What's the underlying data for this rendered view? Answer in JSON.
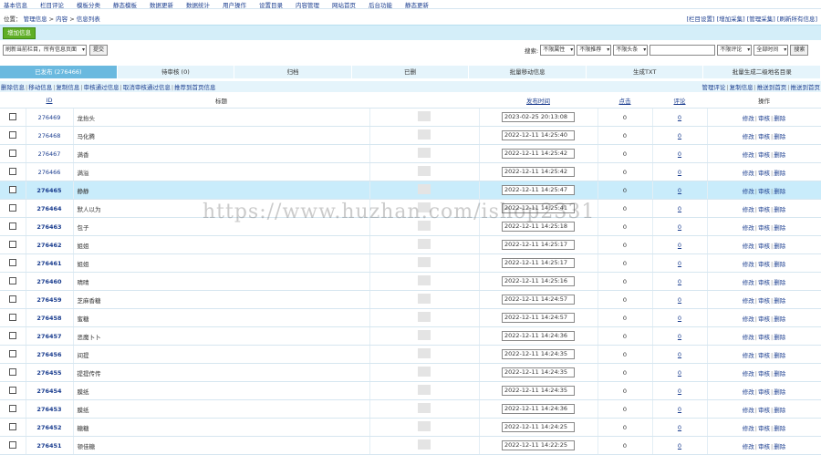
{
  "topnav": [
    "基本信息",
    "栏目评论",
    "模板分类",
    "静态模板",
    "数据更新",
    "数据统计",
    "用户操作",
    "设置目录",
    "内容管理",
    "网站首页",
    "后台功能",
    "静态更新"
  ],
  "breadcrumb": {
    "prefix": "位置：",
    "parts": [
      "管理信息",
      "内容",
      "信息列表"
    ]
  },
  "top_right": "[栏目设置] [增加采集] [管理采集] [刷新所有信息]",
  "add_button": "增加信息",
  "filter": {
    "select1": "刷新当前栏目，所有信息页面",
    "btn1": "提交",
    "label": "搜索:",
    "select2": "不限属性",
    "select3": "不限推荐",
    "select4": "不限头条",
    "select5": "不限评论",
    "select6": "全部时间",
    "btn2": "搜索"
  },
  "tabs": [
    "已发布 (276466)",
    "待审核 (0)",
    "归档",
    "已删",
    "批量移动信息",
    "生成TXT",
    "批量生成二级地名目录"
  ],
  "subactions_left": [
    "删除信息",
    "移动信息",
    "复制信息",
    "审核通过信息",
    "取消审核通过信息",
    "推荐到首页信息"
  ],
  "subactions_right": [
    "管理评论",
    "复制信息",
    "推送到首页",
    "推送到首页"
  ],
  "columns": {
    "id": "ID",
    "title": "标题",
    "blurred": "",
    "date": "发布时间",
    "clicks": "点击",
    "comments": "评论",
    "ops": "操作"
  },
  "ops": {
    "edit": "修改",
    "check": "审核",
    "del": "删除"
  },
  "rows": [
    {
      "id": "276469",
      "title": "龙抬头",
      "date": "2023-02-25 20:13:08",
      "clicks": "0",
      "comments": "0",
      "bold": false,
      "hl": false
    },
    {
      "id": "276468",
      "title": "马化腾",
      "date": "2022-12-11 14:25:40",
      "clicks": "0",
      "comments": "0",
      "bold": false,
      "hl": false
    },
    {
      "id": "276467",
      "title": "满香",
      "date": "2022-12-11 14:25:42",
      "clicks": "0",
      "comments": "0",
      "bold": false,
      "hl": false
    },
    {
      "id": "276466",
      "title": "满溢",
      "date": "2022-12-11 14:25:42",
      "clicks": "0",
      "comments": "0",
      "bold": false,
      "hl": false
    },
    {
      "id": "276465",
      "title": "静静",
      "date": "2022-12-11 14:25:47",
      "clicks": "0",
      "comments": "0",
      "bold": true,
      "hl": true
    },
    {
      "id": "276464",
      "title": "默人以为",
      "date": "2022-12-11 14:25:41",
      "clicks": "0",
      "comments": "0",
      "bold": true,
      "hl": false
    },
    {
      "id": "276463",
      "title": "包子",
      "date": "2022-12-11 14:25:18",
      "clicks": "0",
      "comments": "0",
      "bold": true,
      "hl": false
    },
    {
      "id": "276462",
      "title": "姐姐",
      "date": "2022-12-11 14:25:17",
      "clicks": "0",
      "comments": "0",
      "bold": true,
      "hl": false
    },
    {
      "id": "276461",
      "title": "姐姐",
      "date": "2022-12-11 14:25:17",
      "clicks": "0",
      "comments": "0",
      "bold": true,
      "hl": false
    },
    {
      "id": "276460",
      "title": "晴晴",
      "date": "2022-12-11 14:25:16",
      "clicks": "0",
      "comments": "0",
      "bold": true,
      "hl": false
    },
    {
      "id": "276459",
      "title": "芝麻香糖",
      "date": "2022-12-11 14:24:57",
      "clicks": "0",
      "comments": "0",
      "bold": true,
      "hl": false
    },
    {
      "id": "276458",
      "title": "蜜糖",
      "date": "2022-12-11 14:24:57",
      "clicks": "0",
      "comments": "0",
      "bold": true,
      "hl": false
    },
    {
      "id": "276457",
      "title": "恶魔卜卜",
      "date": "2022-12-11 14:24:36",
      "clicks": "0",
      "comments": "0",
      "bold": true,
      "hl": false
    },
    {
      "id": "276456",
      "title": "间提",
      "date": "2022-12-11 14:24:35",
      "clicks": "0",
      "comments": "0",
      "bold": true,
      "hl": false
    },
    {
      "id": "276455",
      "title": "提提传传",
      "date": "2022-12-11 14:24:35",
      "clicks": "0",
      "comments": "0",
      "bold": true,
      "hl": false
    },
    {
      "id": "276454",
      "title": "膜纸",
      "date": "2022-12-11 14:24:35",
      "clicks": "0",
      "comments": "0",
      "bold": true,
      "hl": false
    },
    {
      "id": "276453",
      "title": "膜纸",
      "date": "2022-12-11 14:24:36",
      "clicks": "0",
      "comments": "0",
      "bold": true,
      "hl": false
    },
    {
      "id": "276452",
      "title": "糖糖",
      "date": "2022-12-11 14:24:25",
      "clicks": "0",
      "comments": "0",
      "bold": true,
      "hl": false
    },
    {
      "id": "276451",
      "title": "顿佳糖",
      "date": "2022-12-11 14:22:25",
      "clicks": "0",
      "comments": "0",
      "bold": true,
      "hl": false
    }
  ],
  "watermark": "https://www.huzhan.com/ishop2331"
}
